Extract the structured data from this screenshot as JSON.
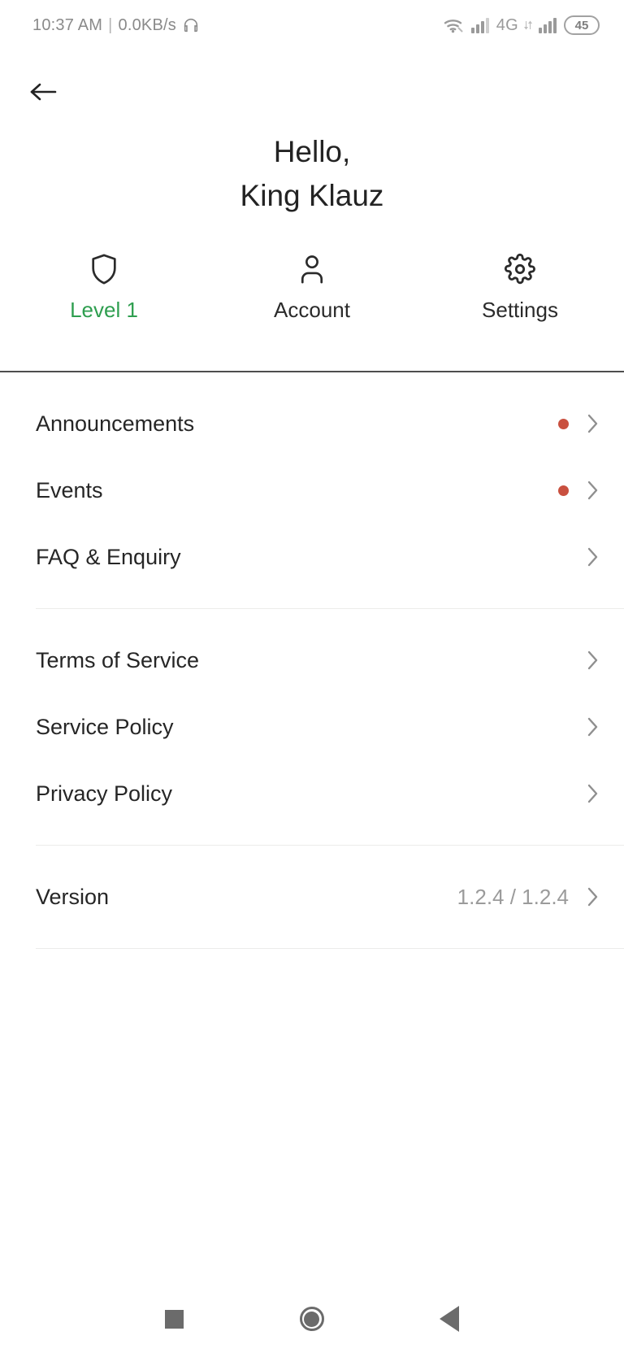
{
  "status_bar": {
    "time": "10:37 AM",
    "separator": "|",
    "network_speed": "0.0KB/s",
    "headphone_icon": "headphone-icon",
    "wifi_icon": "wifi-icon",
    "signal_icon_1": "cellular-signal-icon",
    "network_type": "4G",
    "signal_icon_2": "cellular-signal-icon",
    "battery_level": "45"
  },
  "header": {
    "back_icon": "back-arrow-icon",
    "greeting_line1": "Hello,",
    "greeting_line2": "King Klauz"
  },
  "tabs": [
    {
      "icon": "shield-icon",
      "label": "Level 1",
      "accent": true,
      "accent_color": "#2E9E4F"
    },
    {
      "icon": "person-icon",
      "label": "Account",
      "accent": false
    },
    {
      "icon": "gear-icon",
      "label": "Settings",
      "accent": false
    }
  ],
  "list_groups": [
    {
      "items": [
        {
          "label": "Announcements",
          "badge": true,
          "value": "",
          "chevron": "chevron-right-icon"
        },
        {
          "label": "Events",
          "badge": true,
          "value": "",
          "chevron": "chevron-right-icon"
        },
        {
          "label": "FAQ & Enquiry",
          "badge": false,
          "value": "",
          "chevron": "chevron-right-icon"
        }
      ]
    },
    {
      "items": [
        {
          "label": "Terms of Service",
          "badge": false,
          "value": "",
          "chevron": "chevron-right-icon"
        },
        {
          "label": "Service Policy",
          "badge": false,
          "value": "",
          "chevron": "chevron-right-icon"
        },
        {
          "label": "Privacy Policy",
          "badge": false,
          "value": "",
          "chevron": "chevron-right-icon"
        }
      ]
    },
    {
      "items": [
        {
          "label": "Version",
          "badge": false,
          "value": "1.2.4 / 1.2.4",
          "chevron": "chevron-right-icon"
        }
      ]
    }
  ],
  "nav_bar": {
    "recents": "recents-square-icon",
    "home": "home-circle-icon",
    "back": "back-triangle-icon"
  },
  "colors": {
    "accent_green": "#2E9E4F",
    "badge_red": "#C9503F",
    "text_primary": "#262626",
    "text_muted": "#9B9B9B",
    "divider": "#ECECEA"
  }
}
